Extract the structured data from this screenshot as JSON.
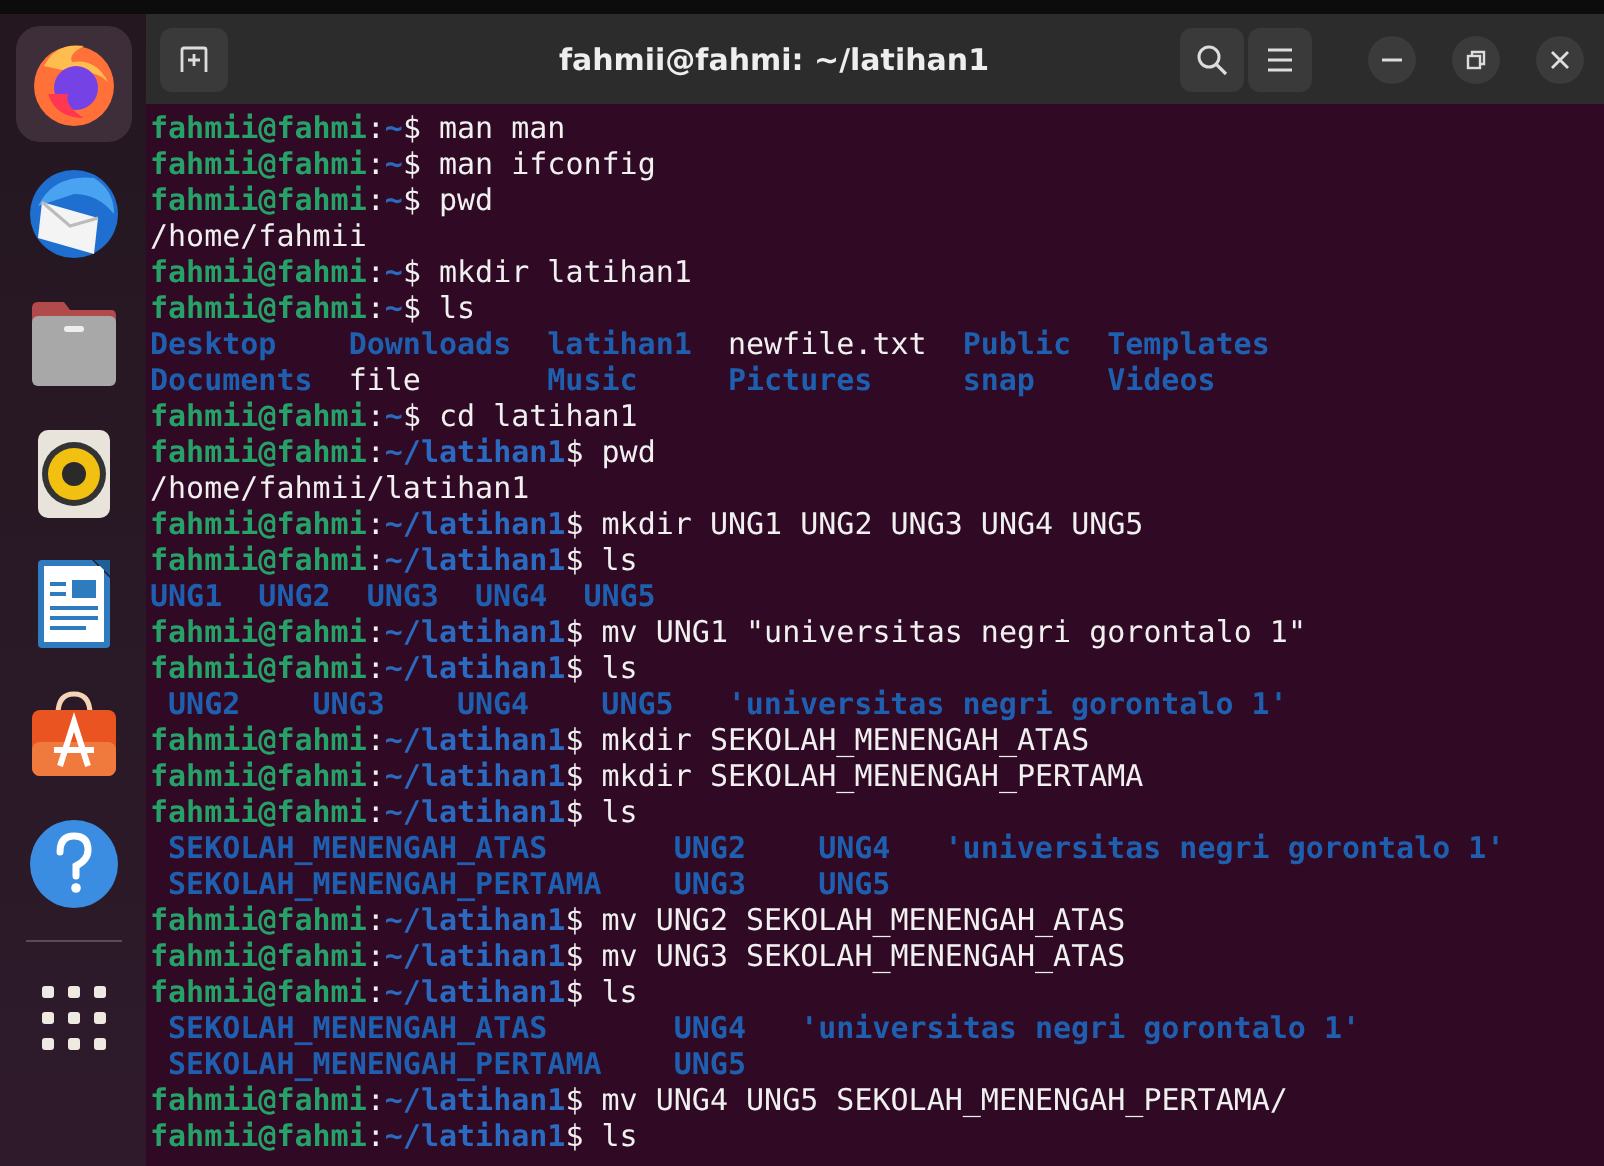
{
  "dock": {
    "items": [
      {
        "kind": "browser",
        "selected": true
      },
      {
        "kind": "mail",
        "selected": false
      },
      {
        "kind": "files",
        "selected": false
      },
      {
        "kind": "music",
        "selected": false
      },
      {
        "kind": "writer",
        "selected": false
      },
      {
        "kind": "store",
        "selected": false
      },
      {
        "kind": "help",
        "selected": false
      },
      {
        "kind": "apps",
        "selected": false
      }
    ]
  },
  "window": {
    "title": "fahmii@fahmi: ~/latihan1"
  },
  "terminal": {
    "lines": [
      {
        "kind": "prompt",
        "user": "fahmii@fahmi",
        "sep": ":",
        "path": "~",
        "command": "$ man man"
      },
      {
        "kind": "prompt",
        "user": "fahmii@fahmi",
        "sep": ":",
        "path": "~",
        "command": "$ man ifconfig"
      },
      {
        "kind": "prompt",
        "user": "fahmii@fahmi",
        "sep": ":",
        "path": "~",
        "command": "$ pwd"
      },
      {
        "kind": "output",
        "text": "/home/fahmii"
      },
      {
        "kind": "prompt",
        "user": "fahmii@fahmi",
        "sep": ":",
        "path": "~",
        "command": "$ mkdir latihan1"
      },
      {
        "kind": "prompt",
        "user": "fahmii@fahmi",
        "sep": ":",
        "path": "~",
        "command": "$ ls"
      },
      {
        "kind": "listing",
        "rows": [
          [
            {
              "text": "Desktop",
              "kind": "dir",
              "indent": false
            },
            {
              "text": "Downloads",
              "kind": "dir",
              "indent": false
            },
            {
              "text": "latihan1",
              "kind": "dir",
              "indent": false
            },
            {
              "text": "newfile.txt",
              "kind": "file",
              "indent": false
            },
            {
              "text": "Public",
              "kind": "dir",
              "indent": false
            },
            {
              "text": "Templates",
              "kind": "dir",
              "indent": false
            }
          ],
          [
            {
              "text": "Documents",
              "kind": "dir",
              "indent": false
            },
            {
              "text": "file",
              "kind": "file",
              "indent": false
            },
            {
              "text": "Music",
              "kind": "dir",
              "indent": false
            },
            {
              "text": "Pictures",
              "kind": "dir",
              "indent": false
            },
            {
              "text": "snap",
              "kind": "dir",
              "indent": false
            },
            {
              "text": "Videos",
              "kind": "dir",
              "indent": false
            }
          ]
        ]
      },
      {
        "kind": "prompt",
        "user": "fahmii@fahmi",
        "sep": ":",
        "path": "~",
        "command": "$ cd latihan1"
      },
      {
        "kind": "prompt",
        "user": "fahmii@fahmi",
        "sep": ":",
        "path": "~/latihan1",
        "command": "$ pwd"
      },
      {
        "kind": "output",
        "text": "/home/fahmii/latihan1"
      },
      {
        "kind": "prompt",
        "user": "fahmii@fahmi",
        "sep": ":",
        "path": "~/latihan1",
        "command": "$ mkdir UNG1 UNG2 UNG3 UNG4 UNG5"
      },
      {
        "kind": "prompt",
        "user": "fahmii@fahmi",
        "sep": ":",
        "path": "~/latihan1",
        "command": "$ ls"
      },
      {
        "kind": "listing",
        "rows": [
          [
            {
              "text": "UNG1",
              "kind": "dir",
              "indent": false
            },
            {
              "text": "UNG2",
              "kind": "dir",
              "indent": false
            },
            {
              "text": "UNG3",
              "kind": "dir",
              "indent": false
            },
            {
              "text": "UNG4",
              "kind": "dir",
              "indent": false
            },
            {
              "text": "UNG5",
              "kind": "dir",
              "indent": false
            }
          ]
        ]
      },
      {
        "kind": "prompt",
        "user": "fahmii@fahmi",
        "sep": ":",
        "path": "~/latihan1",
        "command": "$ mv UNG1 \"universitas negri gorontalo 1\""
      },
      {
        "kind": "prompt",
        "user": "fahmii@fahmi",
        "sep": ":",
        "path": "~/latihan1",
        "command": "$ ls"
      },
      {
        "kind": "listing",
        "rows": [
          [
            {
              "text": "UNG2",
              "kind": "dir",
              "indent": true
            },
            {
              "text": "UNG3",
              "kind": "dir",
              "indent": true
            },
            {
              "text": "UNG4",
              "kind": "dir",
              "indent": true
            },
            {
              "text": "UNG5",
              "kind": "dir",
              "indent": true
            },
            {
              "text": "'universitas negri gorontalo 1'",
              "kind": "dir",
              "indent": false
            }
          ]
        ]
      },
      {
        "kind": "prompt",
        "user": "fahmii@fahmi",
        "sep": ":",
        "path": "~/latihan1",
        "command": "$ mkdir SEKOLAH_MENENGAH_ATAS"
      },
      {
        "kind": "prompt",
        "user": "fahmii@fahmi",
        "sep": ":",
        "path": "~/latihan1",
        "command": "$ mkdir SEKOLAH_MENENGAH_PERTAMA"
      },
      {
        "kind": "prompt",
        "user": "fahmii@fahmi",
        "sep": ":",
        "path": "~/latihan1",
        "command": "$ ls"
      },
      {
        "kind": "listing",
        "rows": [
          [
            {
              "text": "SEKOLAH_MENENGAH_ATAS",
              "kind": "dir",
              "indent": true
            },
            {
              "text": "UNG2",
              "kind": "dir",
              "indent": true
            },
            {
              "text": "UNG4",
              "kind": "dir",
              "indent": true
            },
            {
              "text": "'universitas negri gorontalo 1'",
              "kind": "dir",
              "indent": false
            }
          ],
          [
            {
              "text": "SEKOLAH_MENENGAH_PERTAMA",
              "kind": "dir",
              "indent": true
            },
            {
              "text": "UNG3",
              "kind": "dir",
              "indent": true
            },
            {
              "text": "UNG5",
              "kind": "dir",
              "indent": true
            }
          ]
        ]
      },
      {
        "kind": "prompt",
        "user": "fahmii@fahmi",
        "sep": ":",
        "path": "~/latihan1",
        "command": "$ mv UNG2 SEKOLAH_MENENGAH_ATAS"
      },
      {
        "kind": "prompt",
        "user": "fahmii@fahmi",
        "sep": ":",
        "path": "~/latihan1",
        "command": "$ mv UNG3 SEKOLAH_MENENGAH_ATAS"
      },
      {
        "kind": "prompt",
        "user": "fahmii@fahmi",
        "sep": ":",
        "path": "~/latihan1",
        "command": "$ ls"
      },
      {
        "kind": "listing",
        "rows": [
          [
            {
              "text": "SEKOLAH_MENENGAH_ATAS",
              "kind": "dir",
              "indent": true
            },
            {
              "text": "UNG4",
              "kind": "dir",
              "indent": true
            },
            {
              "text": "'universitas negri gorontalo 1'",
              "kind": "dir",
              "indent": false
            }
          ],
          [
            {
              "text": "SEKOLAH_MENENGAH_PERTAMA",
              "kind": "dir",
              "indent": true
            },
            {
              "text": "UNG5",
              "kind": "dir",
              "indent": true
            }
          ]
        ]
      },
      {
        "kind": "prompt",
        "user": "fahmii@fahmi",
        "sep": ":",
        "path": "~/latihan1",
        "command": "$ mv UNG4 UNG5 SEKOLAH_MENENGAH_PERTAMA/"
      },
      {
        "kind": "prompt",
        "user": "fahmii@fahmi",
        "sep": ":",
        "path": "~/latihan1",
        "command": "$ ls"
      }
    ]
  }
}
